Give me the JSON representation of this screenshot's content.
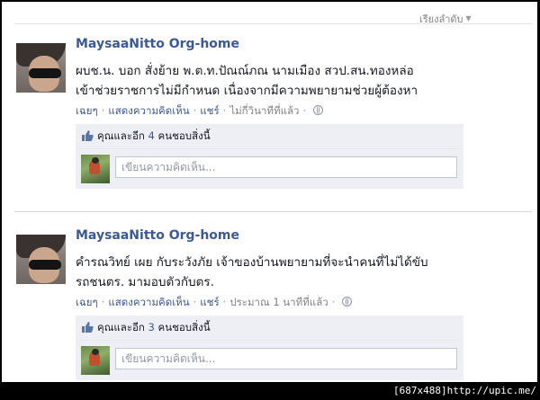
{
  "sort": {
    "label": "เรียงลำดับ"
  },
  "stories": [
    {
      "author": "MaysaaNitto Org-home",
      "message_lines": [
        "ผบช.น. บอก สั่งย้าย พ.ต.ท.ปัณณ์ภณ นามเมือง สวป.สน.ทองหล่อ",
        "เข้าช่วยราชการไม่มีกำหนด เนื่องจากมีความพยายามช่วยผู้ต้องหา"
      ],
      "actions": {
        "like": "เฉยๆ",
        "comment": "แสดงความคิดเห็น",
        "share": "แชร์",
        "time": "ไม่กี่วินาทีที่แล้ว"
      },
      "likes": {
        "prefix": "คุณและอีก",
        "count": "4",
        "suffix": "คนชอบสิ่งนี้"
      },
      "comment_placeholder": "เขียนความคิดเห็น..."
    },
    {
      "author": "MaysaaNitto Org-home",
      "message_lines": [
        "คำรณวิทย์ เผย กับระวังภัย เจ้าของบ้านพยายามที่จะนำคนที่ไม่ได้ขับ",
        "รถชนตร. มามอบตัวกับตร."
      ],
      "actions": {
        "like": "เฉยๆ",
        "comment": "แสดงความคิดเห็น",
        "share": "แชร์",
        "time": "ประมาณ 1 นาทีที่แล้ว"
      },
      "likes": {
        "prefix": "คุณและอีก",
        "count": "3",
        "suffix": "คนชอบสิ่งนี้"
      },
      "comment_placeholder": "เขียนความคิดเห็น..."
    }
  ],
  "watermark": "[687x488]http://upic.me/",
  "colors": {
    "link": "#3b5998",
    "muted": "#808080",
    "ufi_bg": "#edeff4"
  }
}
